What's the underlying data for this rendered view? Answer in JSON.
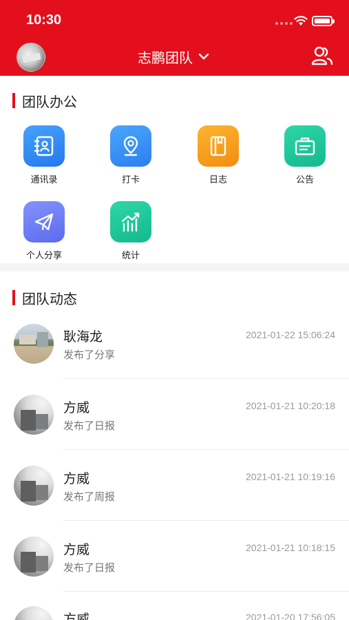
{
  "status_bar": {
    "time": "10:30"
  },
  "header": {
    "team_name": "志鹏团队"
  },
  "office_section": {
    "title": "团队办公",
    "items": [
      {
        "label": "通讯录",
        "icon": "contacts-icon",
        "color": "#2f8df4"
      },
      {
        "label": "打卡",
        "icon": "location-pin-icon",
        "color": "#3a8ef6"
      },
      {
        "label": "日志",
        "icon": "notebook-icon",
        "color": "#f9a21b"
      },
      {
        "label": "公告",
        "icon": "announcement-icon",
        "color": "#19c79a"
      },
      {
        "label": "个人分享",
        "icon": "paper-plane-icon",
        "color": "#6b7cf5"
      },
      {
        "label": "统计",
        "icon": "chart-icon",
        "color": "#19c79a"
      }
    ]
  },
  "feed_section": {
    "title": "团队动态",
    "items": [
      {
        "name": "耿海龙",
        "action": "发布了分享",
        "time": "2021-01-22 15:06:24"
      },
      {
        "name": "方威",
        "action": "发布了日报",
        "time": "2021-01-21 10:20:18"
      },
      {
        "name": "方威",
        "action": "发布了周报",
        "time": "2021-01-21 10:19:16"
      },
      {
        "name": "方威",
        "action": "发布了日报",
        "time": "2021-01-21 10:18:15"
      },
      {
        "name": "方威",
        "action": "",
        "time": "2021-01-20 17:56:05"
      }
    ]
  },
  "colors": {
    "brand_red": "#e30f1c"
  }
}
